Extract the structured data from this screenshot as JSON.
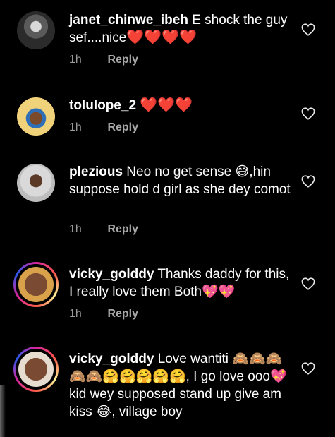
{
  "comments": [
    {
      "username": "janet_chinwe_ibeh",
      "text": "E shock the guy sef....nice",
      "trailing": "❤️❤️❤️❤️",
      "time": "1h",
      "reply": "Reply"
    },
    {
      "username": "tolulope_2",
      "text": "",
      "trailing": "❤️❤️❤️",
      "time": "1h",
      "reply": "Reply"
    },
    {
      "username": "plezious",
      "text": "Neo no get sense 😅,hin suppose hold d girl as she dey comot",
      "trailing": "",
      "time": "1h",
      "reply": "Reply"
    },
    {
      "username": "vicky_golddy",
      "text": "Thanks daddy for this, I really love them Both",
      "trailing": "💖💖",
      "time": "1h",
      "reply": "Reply"
    },
    {
      "username": "vicky_golddy",
      "text": "Love wantiti 🙈🙈🙈🙈🙈🤗🤗🤗🤗🤗, I go love ooo💖 kid wey supposed stand up give am kiss 😂, village boy",
      "trailing": "",
      "time": "",
      "reply": ""
    }
  ],
  "colors": {
    "background": "#000000",
    "text": "#ffffff",
    "meta": "#9a9a9a",
    "heart": "#e0142a"
  },
  "icons": {
    "like": "heart-outline-icon"
  }
}
